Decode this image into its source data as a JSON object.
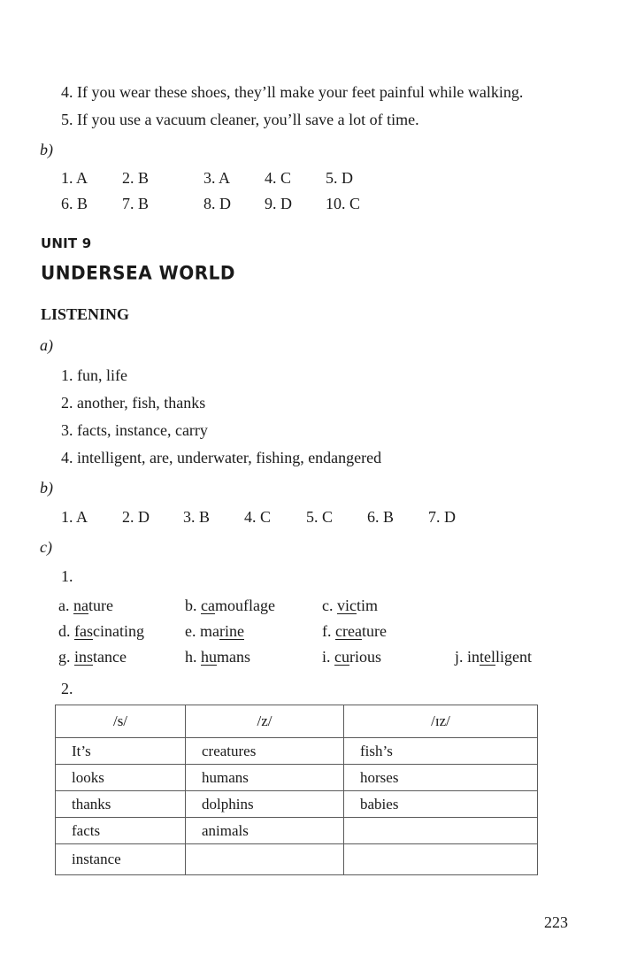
{
  "prev_section": {
    "sentences": [
      "4. If you wear these shoes, they’ll make your feet painful while walking.",
      "5. If you use a vacuum cleaner, you’ll save a lot of time."
    ],
    "b_label": "b)",
    "b_answers_row1": [
      "1. A",
      "2. B",
      "3. A",
      "4. C",
      "5. D"
    ],
    "b_answers_row2": [
      "6. B",
      "7. B",
      "8. D",
      "9. D",
      "10. C"
    ]
  },
  "unit": {
    "label": "UNIT 9",
    "title": "UNDERSEA WORLD"
  },
  "listening": {
    "heading": "LISTENING",
    "a_label": "a)",
    "a_items": [
      "1. fun, life",
      "2. another, fish, thanks",
      "3. facts, instance, carry",
      "4. intelligent, are, underwater, fishing, endangered"
    ],
    "b_label": "b)",
    "b_answers": [
      "1. A",
      "2. D",
      "3. B",
      "4. C",
      "5. C",
      "6. B",
      "7. D"
    ],
    "c_label": "c)",
    "c1_label": "1.",
    "c1_words": [
      {
        "letter": "a.",
        "pre": "",
        "under": "na",
        "post": "ture"
      },
      {
        "letter": "b.",
        "pre": "",
        "under": "ca",
        "post": "mouflage"
      },
      {
        "letter": "c.",
        "pre": "",
        "under": "vic",
        "post": "tim"
      },
      {
        "letter": "d.",
        "pre": "",
        "under": "fas",
        "post": "cinating"
      },
      {
        "letter": "e.",
        "pre": "ma",
        "under": "rine",
        "post": ""
      },
      {
        "letter": "f.",
        "pre": "",
        "under": "crea",
        "post": "ture"
      },
      {
        "letter": "g.",
        "pre": "",
        "under": "ins",
        "post": "tance"
      },
      {
        "letter": "h.",
        "pre": "",
        "under": "hu",
        "post": "mans"
      },
      {
        "letter": "i.",
        "pre": "",
        "under": "cu",
        "post": "rious"
      },
      {
        "letter": "j.",
        "pre": "in",
        "under": "tel",
        "post": "ligent"
      }
    ],
    "c2_label": "2.",
    "table": {
      "headers": [
        "/s/",
        "/z/",
        "/ɪz/"
      ],
      "rows": [
        [
          "It’s",
          "creatures",
          "fish’s"
        ],
        [
          "looks",
          "humans",
          "horses"
        ],
        [
          "thanks",
          "dolphins",
          "babies"
        ],
        [
          "facts",
          "animals",
          ""
        ],
        [
          "instance",
          "",
          ""
        ]
      ]
    }
  },
  "page_number": "223"
}
